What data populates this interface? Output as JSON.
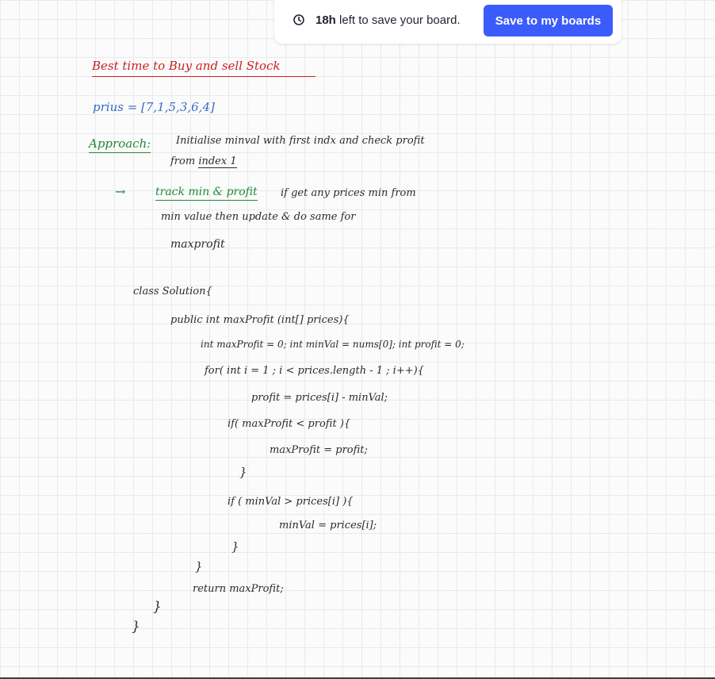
{
  "banner": {
    "time_left": "18h",
    "message_rest": " left to save your board.",
    "save_button_label": "Save to my boards"
  },
  "board": {
    "title": "Best time to Buy and sell Stock",
    "prices": "prius = [7,1,5,3,6,4]",
    "approach_label": "Approach:",
    "approach_text_1": "Initialise minval with first indx and check profit",
    "approach_text_2a": "from ",
    "approach_text_2b": "index 1",
    "arrow": "→",
    "track_text": "track min & profit",
    "track_rest": " if get any prices min from",
    "line_minvalue": "min value  then update & do same for",
    "line_maxprofit": "maxprofit",
    "code": [
      "class Solution{",
      "public int maxProfit (int[] prices){",
      "int maxProfit = 0;   int minVal = nums[0]; int profit = 0;",
      "for( int i = 1 ; i < prices.length - 1 ; i++){",
      "profit = prices[i] - minVal;",
      "if( maxProfit < profit ){",
      "maxProfit = profit;",
      "}",
      "if ( minVal > prices[i] ){",
      "minVal = prices[i];",
      "}",
      "}",
      "return maxProfit;",
      "}",
      "}"
    ]
  }
}
